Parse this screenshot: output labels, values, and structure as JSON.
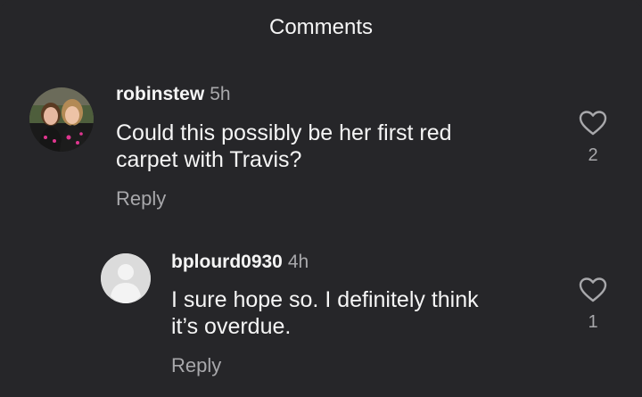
{
  "header": {
    "title": "Comments"
  },
  "comments": [
    {
      "username": "robinstew",
      "time": "5h",
      "text_lines": [
        "Could this possibly be her first red",
        "carpet with Travis?"
      ],
      "reply_label": "Reply",
      "likes": "2"
    },
    {
      "username": "bplourd0930",
      "time": "4h",
      "text_lines": [
        "I sure hope so. I definitely think",
        "it’s overdue."
      ],
      "reply_label": "Reply",
      "likes": "1"
    }
  ],
  "colors": {
    "background": "#262629",
    "primary_text": "#f5f5f5",
    "secondary_text": "#a8a8ab"
  }
}
